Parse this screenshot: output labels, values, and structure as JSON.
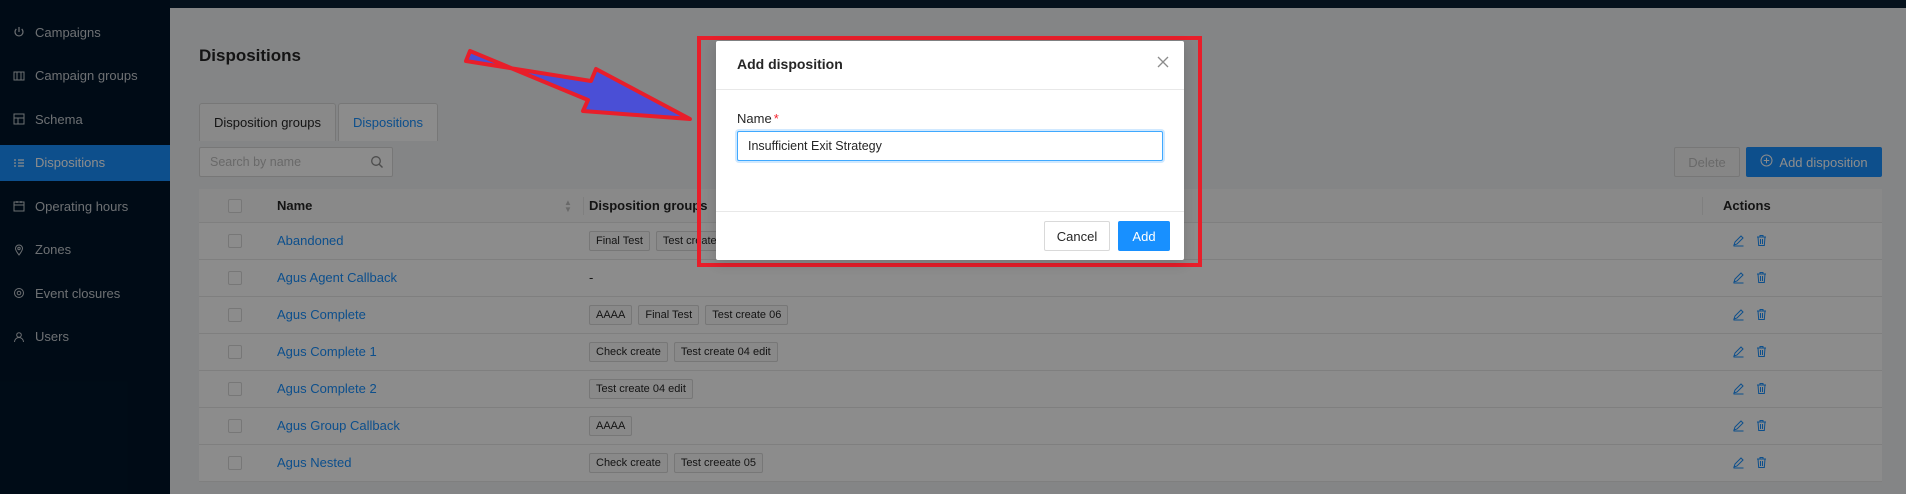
{
  "sidebar": {
    "items": [
      {
        "label": "Campaigns",
        "icon": "power-icon",
        "active": false
      },
      {
        "label": "Campaign groups",
        "icon": "groups-icon",
        "active": false
      },
      {
        "label": "Schema",
        "icon": "schema-icon",
        "active": false
      },
      {
        "label": "Dispositions",
        "icon": "list-icon",
        "active": true
      },
      {
        "label": "Operating hours",
        "icon": "calendar-icon",
        "active": false
      },
      {
        "label": "Zones",
        "icon": "location-pin-icon",
        "active": false
      },
      {
        "label": "Event closures",
        "icon": "event-icon",
        "active": false
      },
      {
        "label": "Users",
        "icon": "user-icon",
        "active": false
      }
    ]
  },
  "page": {
    "title": "Dispositions"
  },
  "tabs": [
    {
      "label": "Disposition groups",
      "active": false
    },
    {
      "label": "Dispositions",
      "active": true
    }
  ],
  "search": {
    "placeholder": "Search by name"
  },
  "toolbar": {
    "delete_label": "Delete",
    "add_label": "Add disposition"
  },
  "table": {
    "columns": {
      "name": "Name",
      "groups": "Disposition groups",
      "actions": "Actions"
    },
    "rows": [
      {
        "name": "Abandoned",
        "groups": [
          "Final Test",
          "Test create"
        ]
      },
      {
        "name": "Agus Agent Callback",
        "groups": [],
        "empty": "-"
      },
      {
        "name": "Agus Complete",
        "groups": [
          "AAAA",
          "Final Test",
          "Test create 06"
        ]
      },
      {
        "name": "Agus Complete 1",
        "groups": [
          "Check create",
          "Test create 04 edit"
        ]
      },
      {
        "name": "Agus Complete 2",
        "groups": [
          "Test create 04 edit"
        ]
      },
      {
        "name": "Agus Group Callback",
        "groups": [
          "AAAA"
        ]
      },
      {
        "name": "Agus Nested",
        "groups": [
          "Check create",
          "Test creeate 05"
        ]
      }
    ]
  },
  "modal": {
    "title": "Add disposition",
    "field_label": "Name",
    "required_mark": "*",
    "field_value": "Insufficient Exit Strategy",
    "cancel_label": "Cancel",
    "ok_label": "Add"
  },
  "colors": {
    "primary": "#1890ff",
    "sidebar_bg": "#001529",
    "annotation": "#e81e2a",
    "arrow_fill": "#4a4fd6"
  }
}
